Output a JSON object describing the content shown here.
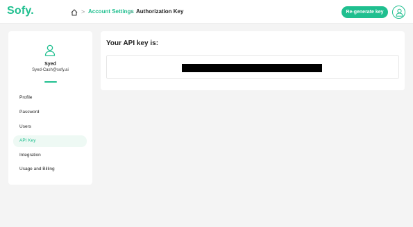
{
  "header": {
    "logo": "Sofy.",
    "breadcrumb": {
      "home_icon": "home-icon",
      "separator": ">",
      "link": "Account Settings",
      "current": "Authorization Key"
    },
    "regenerate_label": "Re-generate key",
    "profile_icon": "user-icon"
  },
  "sidebar": {
    "user": {
      "name": "Syed",
      "email": "Syed-Cash@sofy.ai"
    },
    "items": [
      {
        "label": "Profile",
        "active": false
      },
      {
        "label": "Password",
        "active": false
      },
      {
        "label": "Users",
        "active": false
      },
      {
        "label": "API Key",
        "active": true
      },
      {
        "label": "Integration",
        "active": false
      },
      {
        "label": "Usage and Billing",
        "active": false
      }
    ]
  },
  "main": {
    "title": "Your API key is:",
    "api_key_redacted": true
  },
  "colors": {
    "accent": "#1fbf8f",
    "background": "#f4f4f4",
    "card": "#ffffff",
    "active_item_bg": "#eef9f4"
  }
}
